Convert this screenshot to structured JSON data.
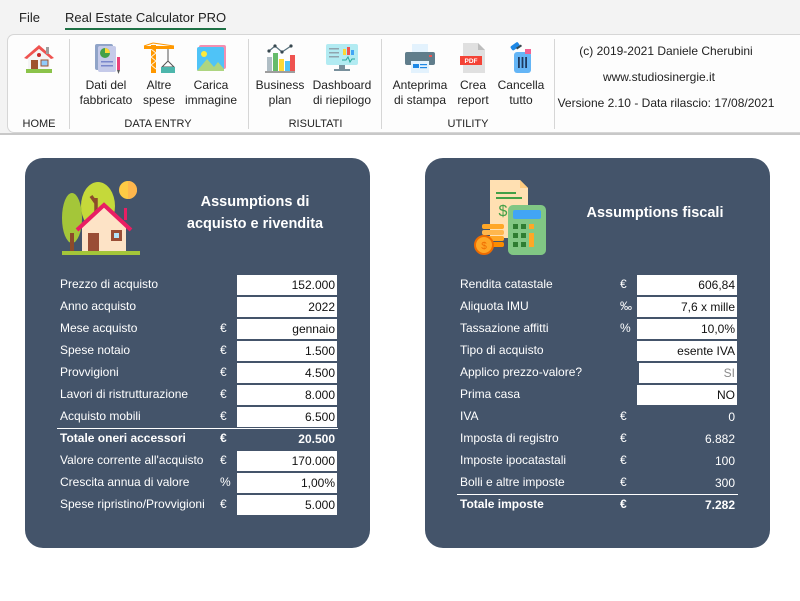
{
  "menu": {
    "tabs": [
      {
        "label": "File",
        "active": false
      },
      {
        "label": "Real Estate Calculator PRO",
        "active": true
      }
    ],
    "accent_color": "#1e7145"
  },
  "ribbon": {
    "groups": [
      {
        "label": "HOME",
        "buttons": [
          {
            "label": "",
            "icon": "home-icon"
          }
        ]
      },
      {
        "label": "DATA ENTRY",
        "buttons": [
          {
            "label": "Dati del\nfabbricato",
            "icon": "document-chart-icon"
          },
          {
            "label": "Altre\nspese",
            "icon": "crane-icon"
          },
          {
            "label": "Carica\nimmagine",
            "icon": "image-icon"
          }
        ]
      },
      {
        "label": "RISULTATI",
        "buttons": [
          {
            "label": "Business\nplan",
            "icon": "bar-chart-icon"
          },
          {
            "label": "Dashboard\ndi riepilogo",
            "icon": "dashboard-monitor-icon"
          }
        ]
      },
      {
        "label": "UTILITY",
        "buttons": [
          {
            "label": "Anteprima\ndi stampa",
            "icon": "printer-icon"
          },
          {
            "label": "Crea\nreport",
            "icon": "pdf-icon"
          },
          {
            "label": "Cancella\ntutto",
            "icon": "trash-icon"
          }
        ]
      }
    ],
    "info": {
      "copyright": "(c) 2019-2021 Daniele Cherubini",
      "website": "www.studiosinergie.it",
      "version": "Versione 2.10 - Data rilascio: 17/08/2021"
    }
  },
  "cards": {
    "acquisto": {
      "title_line1": "Assumptions di",
      "title_line2": "acquisto e rivendita",
      "icon": "house-trees-icon",
      "rows": [
        {
          "label": "Prezzo di acquisto",
          "unit": "",
          "value": "152.000",
          "type": "input"
        },
        {
          "label": "Anno acquisto",
          "unit": "",
          "value": "2022",
          "type": "input"
        },
        {
          "label": "Mese acquisto",
          "unit": "€",
          "value": "gennaio",
          "type": "input"
        },
        {
          "label": "Spese notaio",
          "unit": "€",
          "value": "1.500",
          "type": "input"
        },
        {
          "label": "Provvigioni",
          "unit": "€",
          "value": "4.500",
          "type": "input"
        },
        {
          "label": "Lavori di ristrutturazione",
          "unit": "€",
          "value": "8.000",
          "type": "input"
        },
        {
          "label": "Acquisto mobili",
          "unit": "€",
          "value": "6.500",
          "type": "input"
        },
        {
          "label": "Totale oneri accessori",
          "unit": "€",
          "value": "20.500",
          "type": "total"
        },
        {
          "label": "Valore corrente all'acquisto",
          "unit": "€",
          "value": "170.000",
          "type": "input"
        },
        {
          "label": "Crescita annua di valore",
          "unit": "%",
          "value": "1,00%",
          "type": "input"
        },
        {
          "label": "Spese ripristino/Provvigioni",
          "unit": "€",
          "value": "5.000",
          "type": "input"
        }
      ]
    },
    "fiscali": {
      "title_line1": "Assumptions fiscali",
      "icon": "tax-calculator-icon",
      "rows": [
        {
          "label": "Rendita catastale",
          "unit": "€",
          "value": "606,84",
          "type": "input"
        },
        {
          "label": "Aliquota IMU",
          "unit": "‰",
          "value": "7,6 x mille",
          "type": "input"
        },
        {
          "label": "Tassazione affitti",
          "unit": "%",
          "value": "10,0%",
          "type": "input"
        },
        {
          "label": "Tipo di acquisto",
          "unit": "",
          "value": "esente IVA",
          "type": "input"
        },
        {
          "label": "Applico prezzo-valore?",
          "unit": "",
          "value": "SI",
          "type": "muted"
        },
        {
          "label": "Prima casa",
          "unit": "",
          "value": "NO",
          "type": "input"
        },
        {
          "label": "IVA",
          "unit": "€",
          "value": "0",
          "type": "plain"
        },
        {
          "label": "Imposta di registro",
          "unit": "€",
          "value": "6.882",
          "type": "plain"
        },
        {
          "label": "Imposte ipocatastali",
          "unit": "€",
          "value": "100",
          "type": "plain"
        },
        {
          "label": "Bolli e altre imposte",
          "unit": "€",
          "value": "300",
          "type": "plain"
        },
        {
          "label": "Totale imposte",
          "unit": "€",
          "value": "7.282",
          "type": "total"
        }
      ]
    },
    "card_color": "#44546a"
  }
}
